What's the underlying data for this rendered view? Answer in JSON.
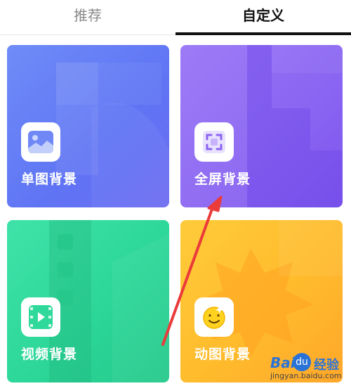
{
  "tabs": [
    {
      "label": "推荐",
      "active": false
    },
    {
      "label": "自定义",
      "active": true
    }
  ],
  "cards": [
    {
      "label": "单图背景",
      "icon": "image-icon",
      "color": "#6f80f6"
    },
    {
      "label": "全屏背景",
      "icon": "fullscreen-icon",
      "color": "#8b66f2"
    },
    {
      "label": "视频背景",
      "icon": "video-play-icon",
      "color": "#2bd597"
    },
    {
      "label": "动图背景",
      "icon": "animated-sticker-icon",
      "color": "#ffbb2c"
    }
  ],
  "annotation": {
    "arrow_color": "#ea3a3a"
  },
  "watermark": {
    "logo_text": "Bai",
    "cn_text": "经验",
    "url": "jingyan.baidu.com"
  }
}
